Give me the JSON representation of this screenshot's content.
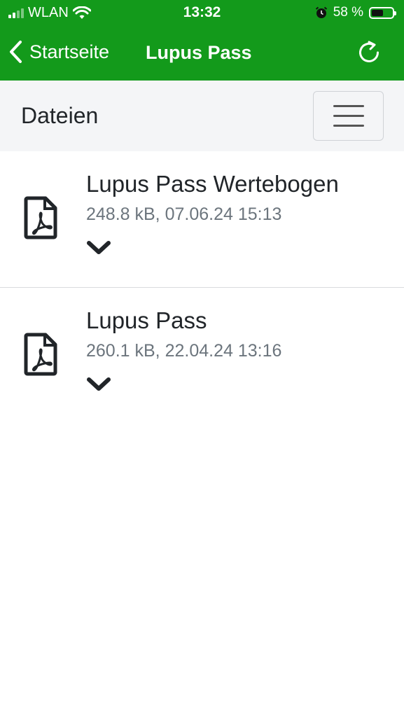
{
  "status_bar": {
    "carrier": "WLAN",
    "time": "13:32",
    "battery_percent": "58 %",
    "battery_level": 0.58
  },
  "nav": {
    "back_label": "Startseite",
    "title": "Lupus Pass",
    "refresh_icon": "refresh-icon"
  },
  "toolbar": {
    "title": "Dateien",
    "menu_icon": "hamburger-menu-icon"
  },
  "files": [
    {
      "name": "Lupus Pass Wertebogen",
      "meta": "248.8 kB, 07.06.24 15:13",
      "icon": "pdf-file-icon"
    },
    {
      "name": "Lupus Pass",
      "meta": "260.1 kB, 22.04.24 13:16",
      "icon": "pdf-file-icon"
    }
  ],
  "colors": {
    "brand_green": "#139a1b",
    "toolbar_bg": "#f4f5f7",
    "meta_text": "#6c757d"
  }
}
